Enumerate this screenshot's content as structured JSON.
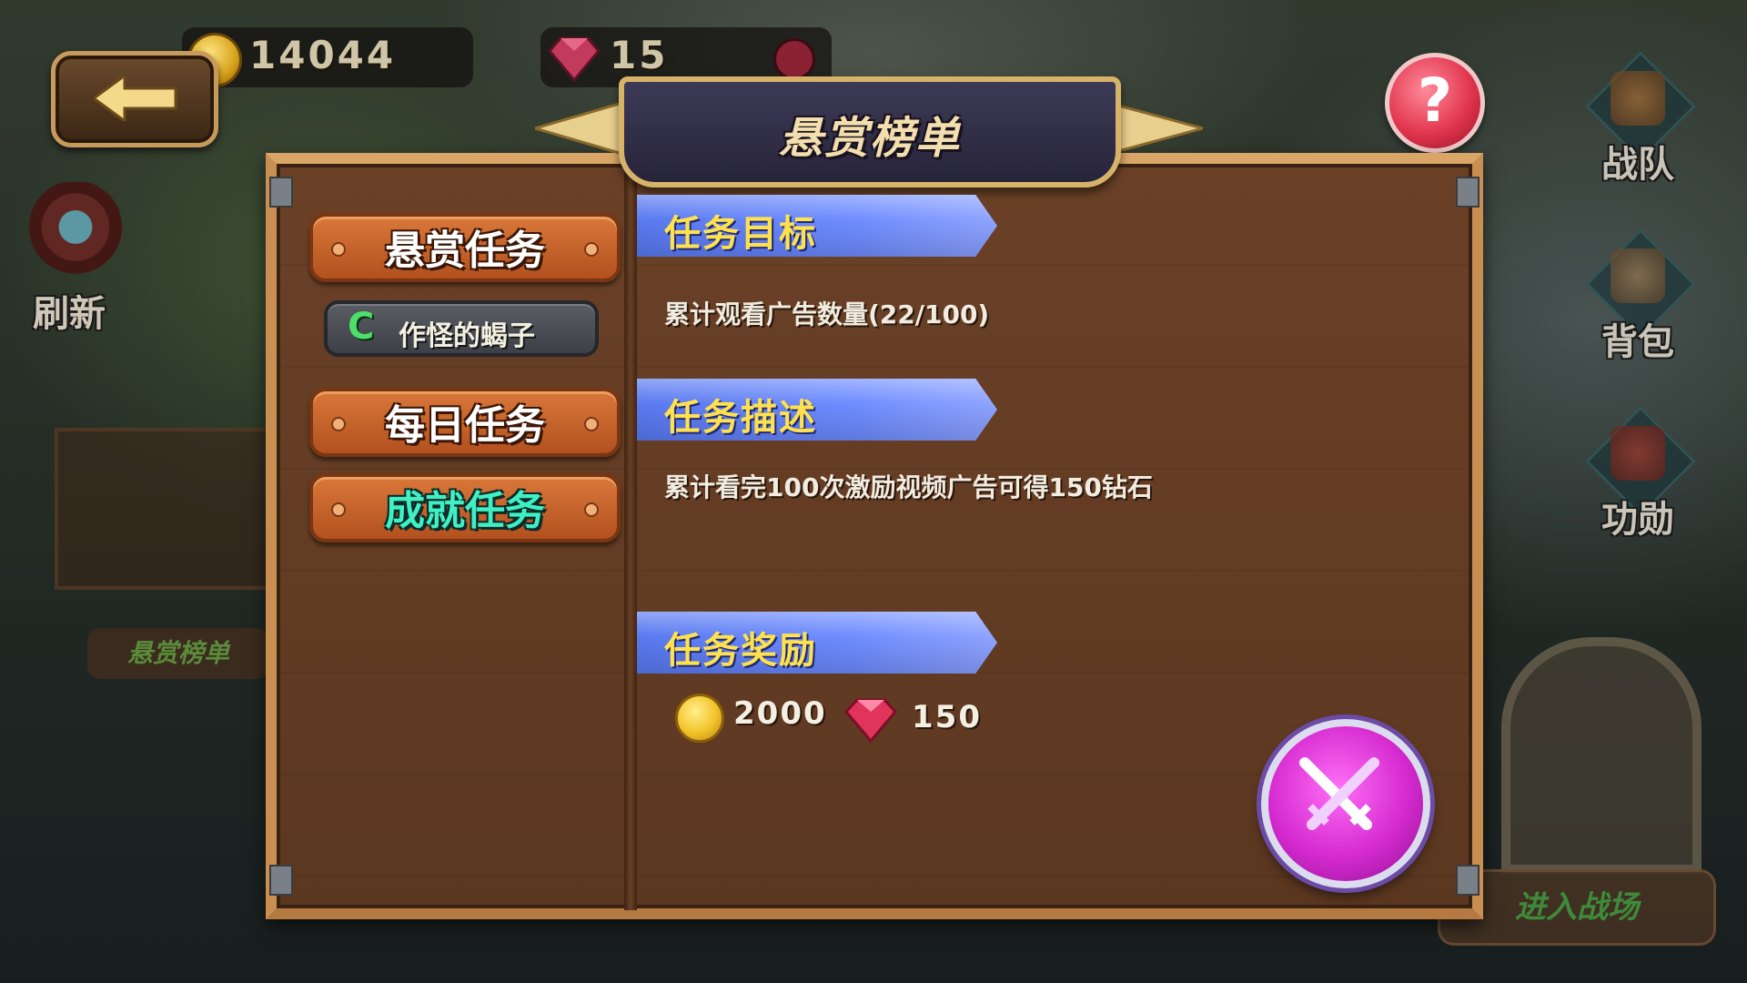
{
  "hud": {
    "coins": "14044",
    "gems": "15"
  },
  "title": "悬赏榜单",
  "left_menu": {
    "refresh_label": "刷新",
    "board_label": "悬赏榜单"
  },
  "tabs": [
    {
      "label": "悬赏任务",
      "active": true
    },
    {
      "label": "每日任务",
      "active": false
    },
    {
      "label": "成就任务",
      "active": false
    }
  ],
  "sub_task": {
    "status": "C",
    "name": "作怪的蝎子"
  },
  "sections": {
    "goal_header": "任务目标",
    "goal_text": "累计观看广告数量(22/100)",
    "desc_header": "任务描述",
    "desc_text": "累计看完100次激励视频广告可得150钻石",
    "reward_header": "任务奖励"
  },
  "rewards": {
    "coins": "2000",
    "gems": "150"
  },
  "right_menu": [
    {
      "label": "战队",
      "icon": "team-icon"
    },
    {
      "label": "背包",
      "icon": "backpack-icon"
    },
    {
      "label": "功勋",
      "icon": "merit-scroll-icon"
    }
  ],
  "enter_battle": "进入战场",
  "help": "?",
  "colors": {
    "panel_wood": "#5c3720",
    "tab_orange": "#d9773a",
    "section_blue": "#6f8dff",
    "section_text": "#ffe14d",
    "fight_purple": "#d52ad0"
  }
}
